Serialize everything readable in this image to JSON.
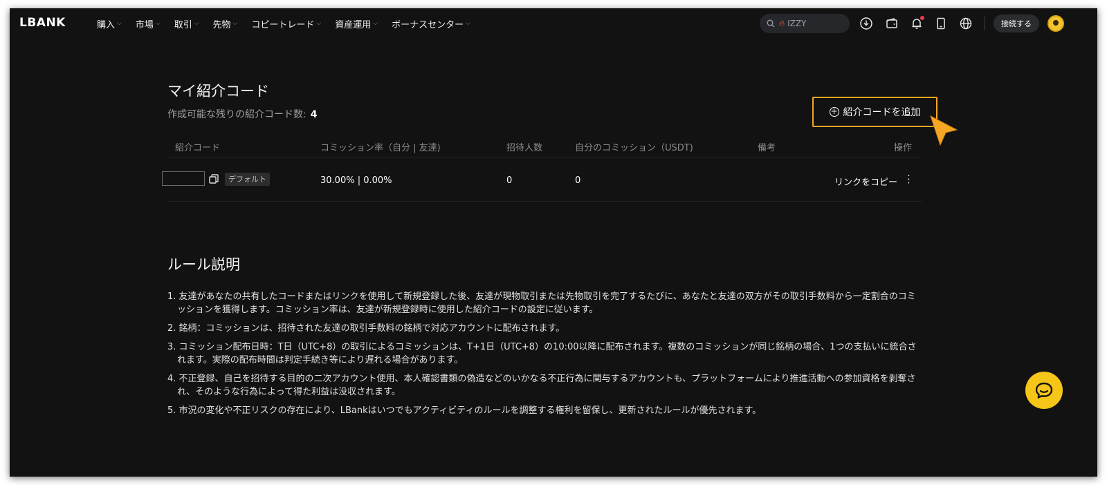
{
  "header": {
    "logo": "LBANK",
    "nav": [
      {
        "label": "購入"
      },
      {
        "label": "市場"
      },
      {
        "label": "取引"
      },
      {
        "label": "先物"
      },
      {
        "label": "コピートレード"
      },
      {
        "label": "資産運用"
      },
      {
        "label": "ボーナスセンター"
      }
    ],
    "search_value": "IZZY",
    "connect_label": "接続する",
    "icons": [
      "download-icon",
      "wallet-icon",
      "bell-icon",
      "mobile-icon",
      "globe-icon"
    ]
  },
  "referral": {
    "title": "マイ紹介コード",
    "remaining_label": "作成可能な残りの紹介コード数:",
    "remaining_count": "4",
    "add_button_label": "紹介コードを追加",
    "columns": [
      "紹介コード",
      "コミッション率（自分 | 友達)",
      "招待人数",
      "自分のコミッション（USDT)",
      "備考",
      "操作"
    ],
    "row": {
      "code": "",
      "badge": "デフォルト",
      "rate": "30.00% | 0.00%",
      "invites": "0",
      "commission": "0",
      "note": "",
      "copy_link": "リンクをコピー"
    }
  },
  "rules": {
    "title": "ルール説明",
    "items": [
      "1. 友達があなたの共有したコードまたはリンクを使用して新規登録した後、友達が現物取引または先物取引を完了するたびに、あなたと友達の双方がその取引手数料から一定割合のコミッションを獲得します。コミッション率は、友達が新規登録時に使用した紹介コードの設定に従います。",
      "2. 銘柄：コミッションは、招待された友達の取引手数料の銘柄で対応アカウントに配布されます。",
      "3. コミッション配布日時：T日（UTC+8）の取引によるコミッションは、T+1日（UTC+8）の10:00以降に配布されます。複数のコミッションが同じ銘柄の場合、1つの支払いに統合されます。実際の配布時間は判定手続き等により遅れる場合があります。",
      "4. 不正登録、自己を招待する目的の二次アカウント使用、本人確認書類の偽造などのいかなる不正行為に関与するアカウントも、プラットフォームにより推進活動への参加資格を剥奪され、そのような行為によって得た利益は没収されます。",
      "5. 市況の変化や不正リスクの存在により、LBankはいつでもアクティビティのルールを調整する権利を留保し、更新されたルールが優先されます。"
    ]
  },
  "colors": {
    "background": "#121212",
    "accent": "#f5a623",
    "chat": "#f5c518"
  }
}
